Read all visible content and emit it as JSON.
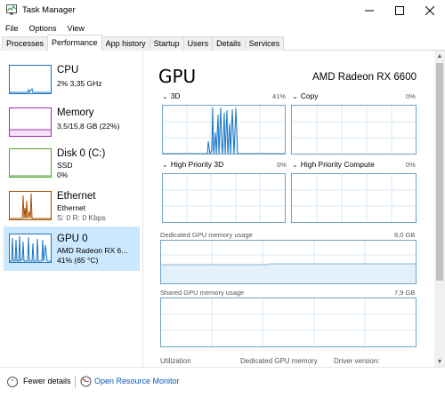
{
  "window": {
    "title": "Task Manager",
    "accent": "#0078d7"
  },
  "menu": [
    "File",
    "Options",
    "View"
  ],
  "tabs": [
    "Processes",
    "Performance",
    "App history",
    "Startup",
    "Users",
    "Details",
    "Services"
  ],
  "active_tab": "Performance",
  "sidebar": [
    {
      "name": "CPU",
      "sub1": "2% 3,35 GHz",
      "sub2": "",
      "color": "#1775c4"
    },
    {
      "name": "Memory",
      "sub1": "3,5/15,8 GB (22%)",
      "sub2": "",
      "color": "#9b2fae"
    },
    {
      "name": "Disk 0 (C:)",
      "sub1": "SSD",
      "sub2": "0%",
      "color": "#4da630"
    },
    {
      "name": "Ethernet",
      "sub1": "Ethernet",
      "sub2": "S: 0 R: 0 Kbps",
      "color": "#a74f01"
    },
    {
      "name": "GPU 0",
      "sub1": "AMD Radeon RX 6...",
      "sub2": "41% (65 °C)",
      "color": "#1775c4"
    }
  ],
  "main": {
    "title": "GPU",
    "model": "AMD Radeon RX 6600",
    "engines": [
      {
        "label": "3D",
        "pct": "41%"
      },
      {
        "label": "Copy",
        "pct": "0%"
      },
      {
        "label": "High Priority 3D",
        "pct": "0%"
      },
      {
        "label": "High Priority Compute",
        "pct": "0%"
      }
    ],
    "dedicated_label": "Dedicated GPU memory usage",
    "dedicated_max": "8,0 GB",
    "shared_label": "Shared GPU memory usage",
    "shared_max": "7,9 GB",
    "stats": [
      "Utilization",
      "Dedicated GPU memory",
      "Driver version:"
    ]
  },
  "footer": {
    "fewer": "Fewer details",
    "monitor": "Open Resource Monitor"
  }
}
